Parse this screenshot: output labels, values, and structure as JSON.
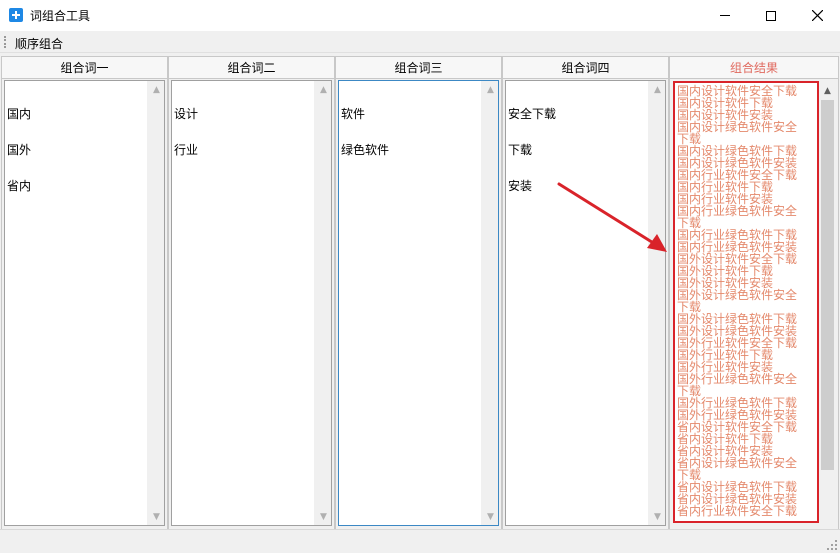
{
  "window": {
    "title": "词组合工具"
  },
  "menu": {
    "item": "顺序组合"
  },
  "columns": [
    {
      "header": "组合词一",
      "lines": [
        "国内",
        "国外",
        "省内"
      ]
    },
    {
      "header": "组合词二",
      "lines": [
        "设计",
        "行业"
      ]
    },
    {
      "header": "组合词三",
      "lines": [
        "软件",
        "绿色软件"
      ]
    },
    {
      "header": "组合词四",
      "lines": [
        "安全下载",
        "下载",
        "安装"
      ]
    }
  ],
  "result": {
    "header": "组合结果",
    "lines": [
      "国内设计软件安全下载",
      "国内设计软件下载",
      "国内设计软件安装",
      "国内设计绿色软件安全下载",
      "国内设计绿色软件下载",
      "国内设计绿色软件安装",
      "国内行业软件安全下载",
      "国内行业软件下载",
      "国内行业软件安装",
      "国内行业绿色软件安全下载",
      "国内行业绿色软件下载",
      "国内行业绿色软件安装",
      "国外设计软件安全下载",
      "国外设计软件下载",
      "国外设计软件安装",
      "国外设计绿色软件安全下载",
      "国外设计绿色软件下载",
      "国外设计绿色软件安装",
      "国外行业软件安全下载",
      "国外行业软件下载",
      "国外行业软件安装",
      "国外行业绿色软件安全下载",
      "国外行业绿色软件下载",
      "国外行业绿色软件安装",
      "省内设计软件安全下载",
      "省内设计软件下载",
      "省内设计软件安装",
      "省内设计绿色软件安全下载",
      "省内设计绿色软件下载",
      "省内设计绿色软件安装",
      "省内行业软件安全下载"
    ]
  },
  "colors": {
    "highlight_border": "#d9232a",
    "result_text": "#e4896c",
    "result_header": "#e06a5f",
    "arrow": "#d9232a"
  },
  "icons": {
    "app": "add-box-icon",
    "minimize": "minimize-icon",
    "maximize": "maximize-icon",
    "close": "close-icon",
    "annotation": "red-arrow-icon"
  }
}
